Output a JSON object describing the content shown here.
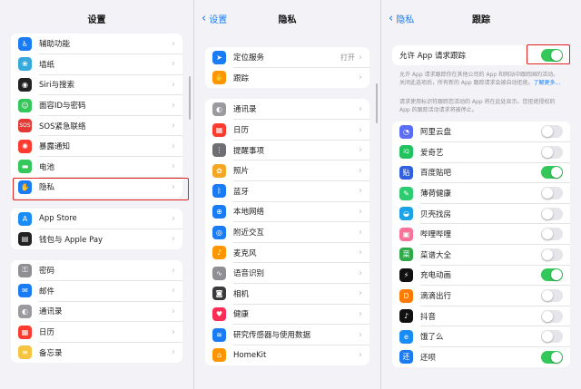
{
  "settings": {
    "title": "设置",
    "group1": [
      {
        "label": "辅助功能",
        "icon": "accessibility-icon",
        "color": "#1a7cf5",
        "glyph": "♿"
      },
      {
        "label": "墙纸",
        "icon": "wallpaper-icon",
        "color": "#36aadc",
        "glyph": "❀"
      },
      {
        "label": "Siri与搜索",
        "icon": "siri-icon",
        "color": "#222222",
        "glyph": "◉"
      },
      {
        "label": "面容ID与密码",
        "icon": "faceid-icon",
        "color": "#34c759",
        "glyph": "☺"
      },
      {
        "label": "SOS紧急联络",
        "icon": "sos-icon",
        "color": "#e53935",
        "glyph": "SOS"
      },
      {
        "label": "暴露通知",
        "icon": "exposure-icon",
        "color": "#ff3b30",
        "glyph": "✺"
      },
      {
        "label": "电池",
        "icon": "battery-icon",
        "color": "#34c759",
        "glyph": "▬"
      },
      {
        "label": "隐私",
        "icon": "privacy-hand-icon",
        "color": "#1a7cf5",
        "glyph": "✋"
      }
    ],
    "group2": [
      {
        "label": "App Store",
        "icon": "appstore-icon",
        "color": "#1a8cf5",
        "glyph": "A"
      },
      {
        "label": "钱包与 Apple Pay",
        "icon": "wallet-icon",
        "color": "#222222",
        "glyph": "▤"
      }
    ],
    "group3": [
      {
        "label": "密码",
        "icon": "key-icon",
        "color": "#8e8e93",
        "glyph": "⚿"
      },
      {
        "label": "邮件",
        "icon": "mail-icon",
        "color": "#1a7cf5",
        "glyph": "✉"
      },
      {
        "label": "通讯录",
        "icon": "contacts-icon",
        "color": "#9a9a9f",
        "glyph": "◐"
      },
      {
        "label": "日历",
        "icon": "calendar-icon",
        "color": "#ff3b30",
        "glyph": "▦"
      },
      {
        "label": "备忘录",
        "icon": "notes-icon",
        "color": "#f5c542",
        "glyph": "≡"
      }
    ]
  },
  "privacy": {
    "back": "设置",
    "title": "隐私",
    "group1": [
      {
        "label": "定位服务",
        "icon": "location-icon",
        "color": "#1a7cf5",
        "glyph": "➤",
        "trail": "打开"
      },
      {
        "label": "跟踪",
        "icon": "tracking-icon",
        "color": "#ff9500",
        "glyph": "✋",
        "trail": ""
      }
    ],
    "group2": [
      {
        "label": "通讯录",
        "icon": "contacts-icon",
        "color": "#9a9a9f",
        "glyph": "◐"
      },
      {
        "label": "日历",
        "icon": "calendar-icon",
        "color": "#ff3b30",
        "glyph": "▦"
      },
      {
        "label": "提醒事项",
        "icon": "reminders-icon",
        "color": "#6e6e73",
        "glyph": "⋮"
      },
      {
        "label": "照片",
        "icon": "photos-icon",
        "color": "#f5a623",
        "glyph": "✿"
      },
      {
        "label": "蓝牙",
        "icon": "bluetooth-icon",
        "color": "#1a7cf5",
        "glyph": "ᛒ"
      },
      {
        "label": "本地网络",
        "icon": "local-network-icon",
        "color": "#1a7cf5",
        "glyph": "⊕"
      },
      {
        "label": "附近交互",
        "icon": "nearby-interaction-icon",
        "color": "#1a7cf5",
        "glyph": "◎"
      },
      {
        "label": "麦克风",
        "icon": "microphone-icon",
        "color": "#ff9500",
        "glyph": "♪"
      },
      {
        "label": "语音识别",
        "icon": "speech-icon",
        "color": "#8e8e93",
        "glyph": "∿"
      },
      {
        "label": "相机",
        "icon": "camera-icon",
        "color": "#3a3a3c",
        "glyph": "◙"
      },
      {
        "label": "健康",
        "icon": "health-icon",
        "color": "#ff2d55",
        "glyph": "♥"
      },
      {
        "label": "研究传感器与使用数据",
        "icon": "research-icon",
        "color": "#1a7cf5",
        "glyph": "≋"
      },
      {
        "label": "HomeKit",
        "icon": "homekit-icon",
        "color": "#ff9500",
        "glyph": "⌂"
      }
    ]
  },
  "tracking": {
    "back": "隐私",
    "title": "跟踪",
    "allow_label": "允许 App 请求跟踪",
    "allow_on": true,
    "desc1": "允许 App 请求跟踪你在其他公司的 App 和网站中跟踪国的活动。关闭此选项后，所有新的 App 跟踪请求会被自动拒绝。",
    "desc1_link": "了解更多…",
    "desc2": "请求使用标识符跟踪您活动的 App 将在此处显示。您拒绝授权的 App 的跟踪活动请求将被停止。",
    "apps": [
      {
        "label": "阿里云盘",
        "icon": "aliyun-drive-icon",
        "color": "#5b6cf5",
        "glyph": "◔",
        "on": false
      },
      {
        "label": "爱奇艺",
        "icon": "iqiyi-icon",
        "color": "#22c35e",
        "glyph": "iQ",
        "on": false
      },
      {
        "label": "百度贴吧",
        "icon": "tieba-icon",
        "color": "#3060e0",
        "glyph": "贴",
        "on": true
      },
      {
        "label": "薄荷健康",
        "icon": "mint-health-icon",
        "color": "#2ecc71",
        "glyph": "✎",
        "on": false
      },
      {
        "label": "贝壳找房",
        "icon": "beike-icon",
        "color": "#1aa3e8",
        "glyph": "◒",
        "on": false
      },
      {
        "label": "哔哩哔哩",
        "icon": "bilibili-icon",
        "color": "#fb7299",
        "glyph": "▣",
        "on": false
      },
      {
        "label": "菜谱大全",
        "icon": "recipes-icon",
        "color": "#2eaa4a",
        "glyph": "菜",
        "on": false
      },
      {
        "label": "充电动画",
        "icon": "charging-animation-icon",
        "color": "#111111",
        "glyph": "⚡",
        "on": true
      },
      {
        "label": "滴滴出行",
        "icon": "didi-icon",
        "color": "#ff7a00",
        "glyph": "D",
        "on": false
      },
      {
        "label": "抖音",
        "icon": "douyin-icon",
        "color": "#111111",
        "glyph": "♪",
        "on": false
      },
      {
        "label": "饿了么",
        "icon": "eleme-icon",
        "color": "#1a8cf5",
        "glyph": "e",
        "on": false
      },
      {
        "label": "还呗",
        "icon": "huanbei-icon",
        "color": "#1a7cf5",
        "glyph": "还",
        "on": true
      }
    ]
  }
}
